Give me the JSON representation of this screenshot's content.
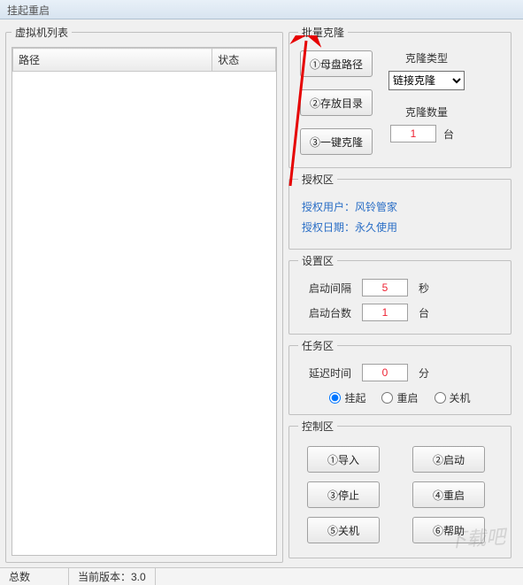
{
  "titlebar": {
    "text": "挂起重启"
  },
  "vm_list": {
    "legend": "虚拟机列表",
    "col_path": "路径",
    "col_status": "状态"
  },
  "clone": {
    "legend": "批量克隆",
    "btn_master": "①母盘路径",
    "btn_savedir": "②存放目录",
    "btn_oneclick": "③一键克隆",
    "type_label": "克隆类型",
    "type_value": "链接克隆",
    "count_label": "克隆数量",
    "count_value": "1",
    "count_unit": "台"
  },
  "auth": {
    "legend": "授权区",
    "user_line": "授权用户：风铃管家",
    "date_line": "授权日期：永久使用"
  },
  "settings": {
    "legend": "设置区",
    "interval_label": "启动间隔",
    "interval_value": "5",
    "interval_unit": "秒",
    "count_label": "启动台数",
    "count_value": "1",
    "count_unit": "台"
  },
  "tasks": {
    "legend": "任务区",
    "delay_label": "延迟时间",
    "delay_value": "0",
    "delay_unit": "分",
    "radio_suspend": "挂起",
    "radio_restart": "重启",
    "radio_shutdown": "关机",
    "selected": "suspend"
  },
  "control": {
    "legend": "控制区",
    "btn_import": "①导入",
    "btn_start": "②启动",
    "btn_stop": "③停止",
    "btn_restart": "④重启",
    "btn_shutdown": "⑤关机",
    "btn_help": "⑥帮助"
  },
  "statusbar": {
    "total_label": "总数",
    "version": "当前版本：3.0"
  },
  "watermark": "下载吧"
}
